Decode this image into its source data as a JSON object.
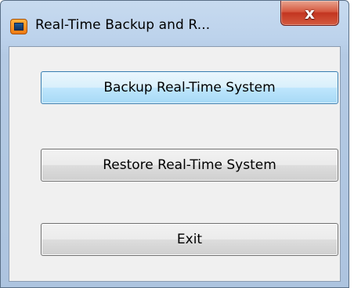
{
  "window": {
    "title": "Real-Time Backup and R...",
    "close_glyph": "x",
    "icon": "app-icon"
  },
  "buttons": {
    "backup_label": "Backup Real-Time System",
    "restore_label": "Restore Real-Time System",
    "exit_label": "Exit"
  },
  "colors": {
    "close_button": "#c33520",
    "focused_button_border": "#3c7fb1",
    "frame": "#b4cae4"
  }
}
